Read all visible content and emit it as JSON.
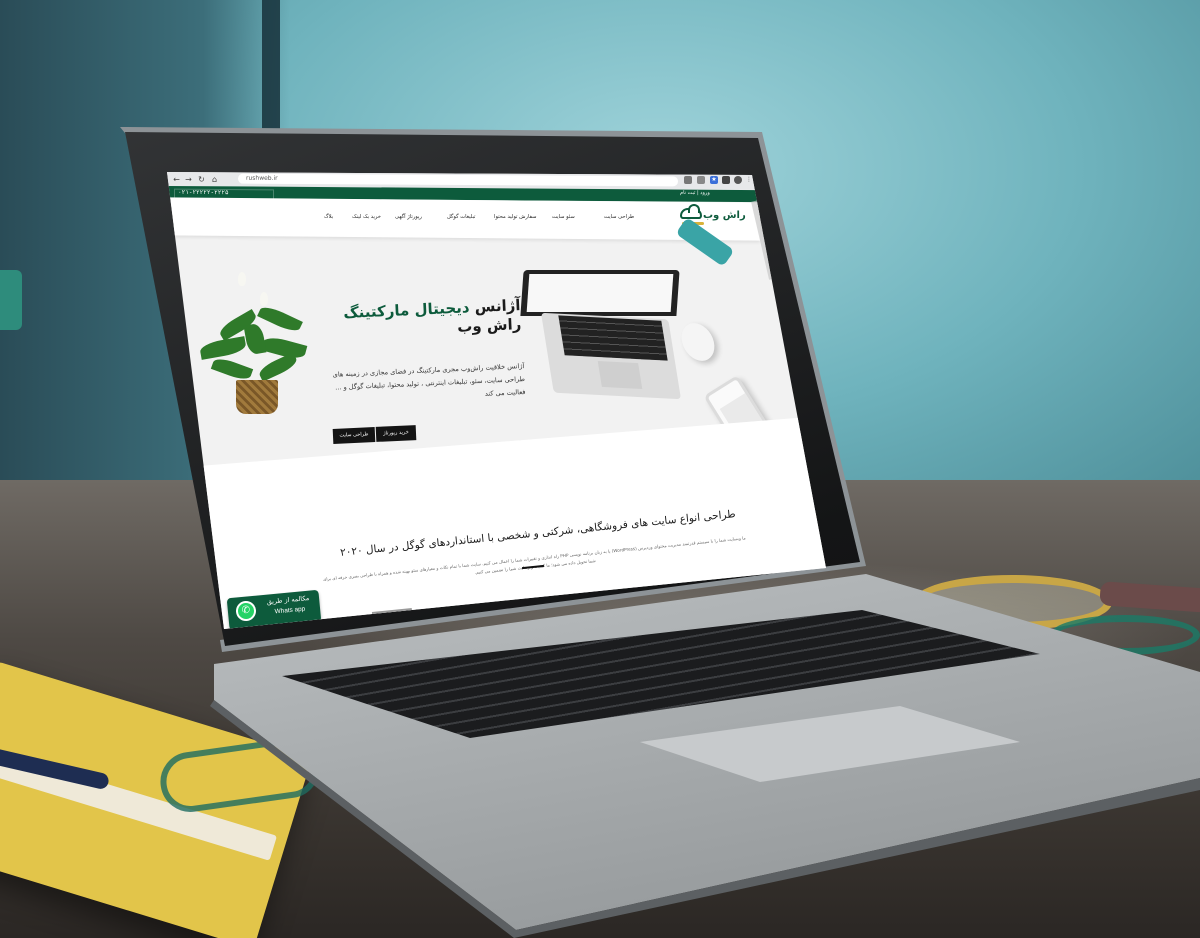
{
  "browser": {
    "url": "rushweb.ir",
    "nav_icons": [
      "back-arrow-icon",
      "forward-arrow-icon",
      "reload-icon",
      "home-icon"
    ]
  },
  "topbar": {
    "phone": "۰۲۱-۲۲۲۲۲-۲۲۲۵",
    "links": "ورود | ثبت نام"
  },
  "brand": {
    "logo_text": "راش وب",
    "primary_color": "#0d5b3c",
    "accent_color": "#d9b23a"
  },
  "nav": {
    "items": [
      "طراحی سایت",
      "سئو سایت",
      "سفارش تولید محتوا",
      "تبلیغات گوگل",
      "رپورتاژ آگهی",
      "خرید بک لینک",
      "بلاگ"
    ]
  },
  "hero": {
    "title_line1_plain": "آژانس ",
    "title_line1_accent": "دیجیتال مارکتینگ",
    "title_line2": "راش وب",
    "description": "آژانس خلاقیت راش‌وب مجری مارکتینگ در فضای مجازی در زمینه های طراحی سایت، سئو، تبلیغات اینترنتی ، تولید محتوا، تبلیغات گوگل و ... فعالیت می کند",
    "button_primary": "خرید رپورتاژ",
    "button_secondary": "طراحی سایت"
  },
  "section": {
    "title": "طراحی انواع سایت های فروشگاهی، شرکتی و شخصی با استانداردهای گوگل در سال ۲۰۲۰",
    "text": "ما وبسایت شما را با سیستم قدرتمند مدیریت محتوای وردپرس (WordPress) یا به زبان برنامه نویسی PHP راه اندازی و تغییرات شما را اعمال می کنیم. سایت شما با تمام نکات و معیارهای سئو بهینه شده و همراه با طراحی بصری حرفه ای برای شما تحویل داده می شود؛ ما کیفیت و رضایت شما را تضمین می کنیم."
  },
  "whatsapp": {
    "line1": "مکالمه از طریق",
    "line2": "Whats app"
  }
}
